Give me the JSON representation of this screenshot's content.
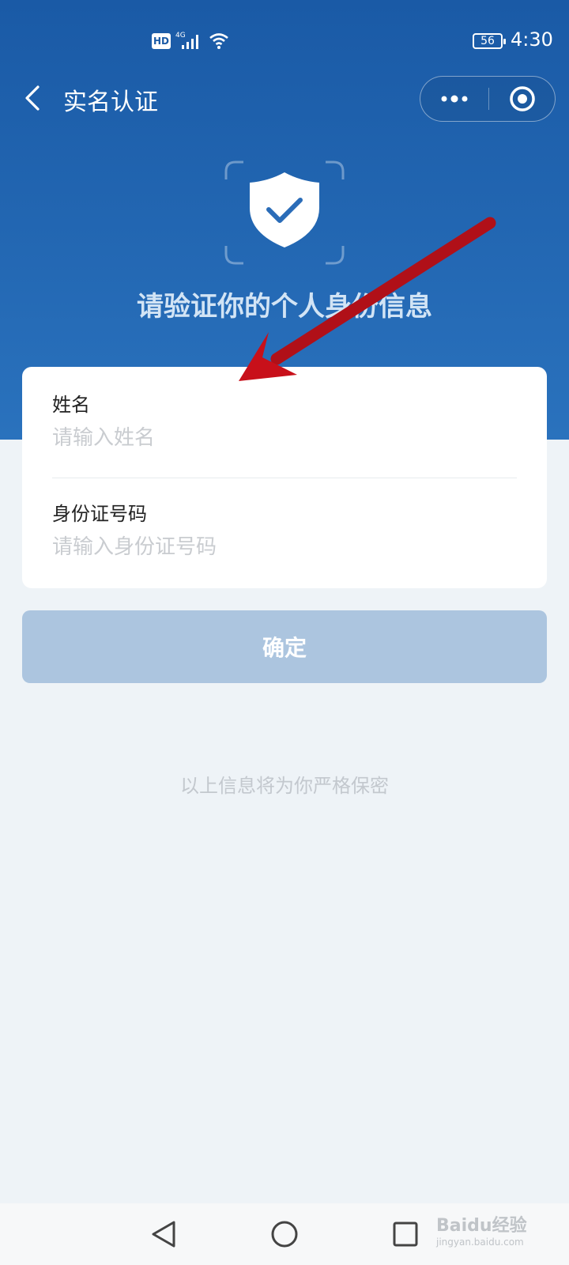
{
  "status_bar": {
    "time": "4:30",
    "battery": "56",
    "hd_badge": "HD",
    "network": "4G"
  },
  "header": {
    "title": "实名认证",
    "more_icon": "ellipsis-icon",
    "close_icon": "target-icon",
    "back_icon": "chevron-left-icon"
  },
  "hero": {
    "heading": "请验证你的个人身份信息",
    "icon": "shield-check-icon"
  },
  "form": {
    "name_label": "姓名",
    "name_placeholder": "请输入姓名",
    "id_label": "身份证号码",
    "id_placeholder": "请输入身份证号码"
  },
  "confirm_label": "确定",
  "privacy_note": "以上信息将为你严格保密",
  "nav": {
    "back_icon": "triangle-back-icon",
    "home_icon": "circle-home-icon",
    "recents_icon": "square-recents-icon"
  },
  "watermark": {
    "brand": "Baidu经验",
    "url": "jingyan.baidu.com"
  },
  "colors": {
    "hero": "#1a5aa6",
    "button": "#acc5df",
    "background": "#eef3f7",
    "annotation_arrow": "#c8101a"
  }
}
